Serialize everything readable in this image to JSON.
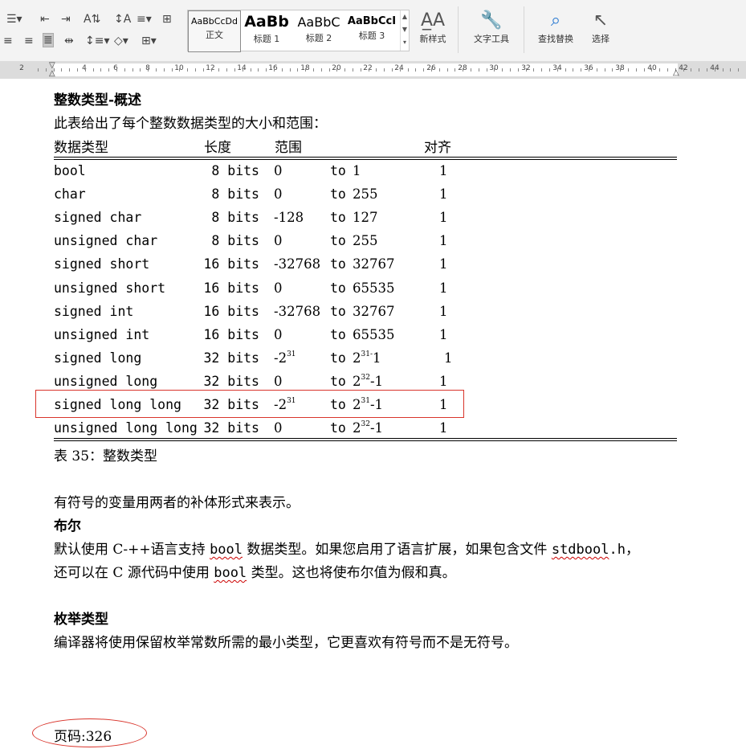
{
  "ribbon": {
    "styles": [
      {
        "sample": "AaBbCcDd",
        "name": "正文"
      },
      {
        "sample": "AaBb",
        "name": "标题 1"
      },
      {
        "sample": "AaBbC",
        "name": "标题 2"
      },
      {
        "sample": "AaBbCcI",
        "name": "标题 3"
      }
    ],
    "new_style_label": "新样式",
    "text_tools_label": "文字工具",
    "find_replace_label": "查找替换",
    "select_label": "选择"
  },
  "ruler": {
    "numbers": [
      "2",
      "2",
      "4",
      "6",
      "8",
      "10",
      "12",
      "14",
      "16",
      "18",
      "20",
      "22",
      "24",
      "26",
      "28",
      "30",
      "32",
      "34",
      "36",
      "38",
      "40",
      "42",
      "44"
    ]
  },
  "document": {
    "section_title": "整数类型-概述",
    "intro": "此表给出了每个整数数据类型的大小和范围：",
    "table": {
      "headers": {
        "type": "数据类型",
        "length": "长度",
        "range": "范围",
        "align": "对齐"
      },
      "rows": [
        {
          "type": "bool",
          "bits": "8 bits",
          "from": "0",
          "to_word": "to",
          "to": "1",
          "to_exp": "",
          "to_tail": "",
          "from_exp": "",
          "align": "1"
        },
        {
          "type": "char",
          "bits": "8 bits",
          "from": "0",
          "to_word": "to",
          "to": "255",
          "to_exp": "",
          "to_tail": "",
          "from_exp": "",
          "align": "1"
        },
        {
          "type": "signed char",
          "bits": "8 bits",
          "from": "-128",
          "to_word": "to",
          "to": "127",
          "to_exp": "",
          "to_tail": "",
          "from_exp": "",
          "align": "1"
        },
        {
          "type": "unsigned char",
          "bits": "8 bits",
          "from": "0",
          "to_word": "to",
          "to": "255",
          "to_exp": "",
          "to_tail": "",
          "from_exp": "",
          "align": "1"
        },
        {
          "type": "signed short",
          "bits": "16 bits",
          "from": "-32768",
          "to_word": "to",
          "to": "32767",
          "to_exp": "",
          "to_tail": "",
          "from_exp": "",
          "align": "1"
        },
        {
          "type": "unsigned short",
          "bits": "16 bits",
          "from": "0",
          "to_word": "to",
          "to": "65535",
          "to_exp": "",
          "to_tail": "",
          "from_exp": "",
          "align": "1"
        },
        {
          "type": "signed int",
          "bits": "16 bits",
          "from": "-32768",
          "to_word": "to",
          "to": "32767",
          "to_exp": "",
          "to_tail": "",
          "from_exp": "",
          "align": "1"
        },
        {
          "type": "unsigned int",
          "bits": "16 bits",
          "from": "0",
          "to_word": "to",
          "to": "65535",
          "to_exp": "",
          "to_tail": "",
          "from_exp": "",
          "align": "1"
        },
        {
          "type": "signed long",
          "bits": "32 bits",
          "from": "-2",
          "from_exp": "31",
          "to_word": "to",
          "to": "2",
          "to_exp": "31-",
          "to_tail": "1",
          "align": "1"
        },
        {
          "type": "unsigned long",
          "bits": "32 bits",
          "from": "0",
          "from_exp": "",
          "to_word": "to",
          "to": "2",
          "to_exp": "32",
          "to_tail": "-1",
          "align": "1"
        },
        {
          "type": "signed long long",
          "bits": "32 bits",
          "from": "-2",
          "from_exp": "31",
          "to_word": "to",
          "to": "2",
          "to_exp": "31",
          "to_tail": "-1",
          "align": "1"
        },
        {
          "type": "unsigned long long",
          "bits": "32 bits",
          "from": "0",
          "from_exp": "",
          "to_word": "to",
          "to": "2",
          "to_exp": "32",
          "to_tail": "-1",
          "align": "1"
        }
      ],
      "caption": "表 35：整数类型"
    },
    "signed_note": "有符号的变量用两者的补体形式来表示。",
    "bool_title": "布尔",
    "bool_text_1a": "默认使用 C-++语言支持 ",
    "bool_text_1b": "bool",
    "bool_text_1c": " 数据类型。如果您启用了语言扩展，如果包含文件 ",
    "bool_text_1d": "stdbool",
    "bool_text_1e": ".h，",
    "bool_text_2a": "还可以在 C 源代码中使用 ",
    "bool_text_2b": "bool",
    "bool_text_2c": " 类型。这也将使布尔值为假和真。",
    "enum_title": "枚举类型",
    "enum_text": "编译器将使用保留枚举常数所需的最小类型，它更喜欢有符号而不是无符号。",
    "page_label": "页码:326"
  },
  "colors": {
    "annotation": "#d9342b",
    "spellcheck": "#cc0000"
  }
}
